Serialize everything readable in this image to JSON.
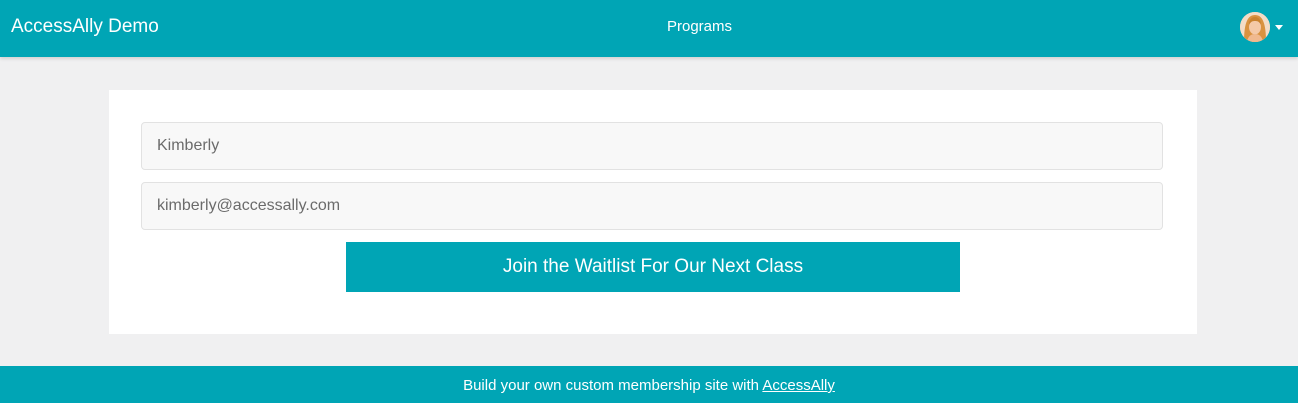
{
  "header": {
    "brand": "AccessAlly Demo",
    "nav": {
      "programs_label": "Programs"
    },
    "user_menu": {
      "avatar_icon": "user-avatar-photo",
      "caret_icon": "caret-down-icon"
    }
  },
  "form": {
    "name_value": "Kimberly",
    "email_value": "kimberly@accessally.com",
    "submit_label": "Join the Waitlist For Our Next Class"
  },
  "footer": {
    "text": "Build your own custom membership site with ",
    "link_label": "AccessAlly"
  },
  "colors": {
    "brand_teal": "#00a5b5",
    "page_background": "#f0f0f1",
    "card_background": "#ffffff",
    "field_background": "#f8f8f8"
  }
}
